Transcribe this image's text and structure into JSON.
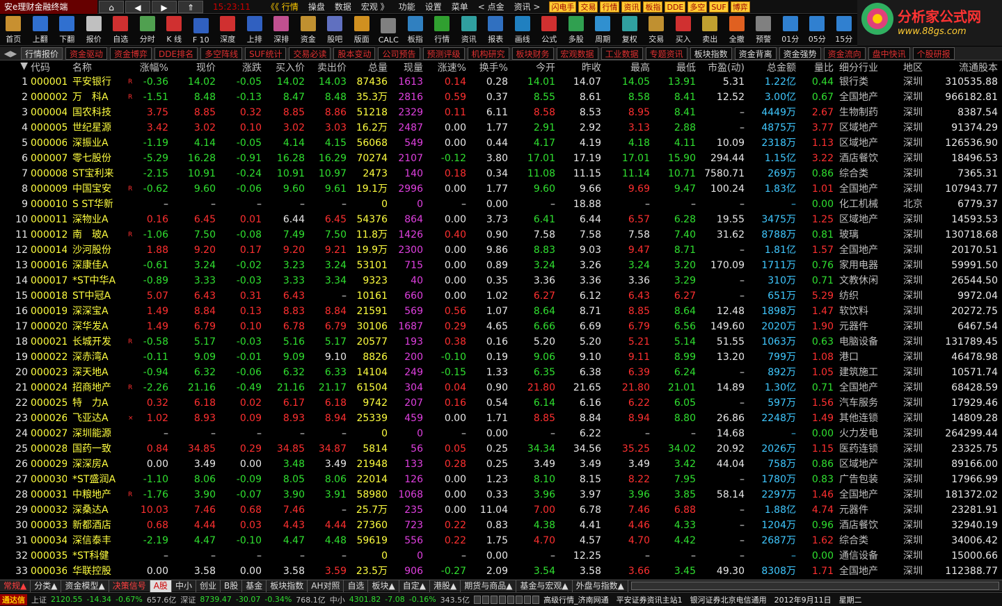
{
  "app": {
    "title": "安e理财金融终端",
    "clock": "15:23:11"
  },
  "menu": [
    "《《 行情",
    "操盘",
    "数据",
    "宏观 》",
    "功能",
    "设置",
    "菜单",
    "< 点金",
    "资讯 >"
  ],
  "quick": [
    "闪电手",
    "交易",
    "行情",
    "资讯",
    "板指",
    "DDE",
    "多空",
    "SUF",
    "博弈"
  ],
  "logo": {
    "line1": "分析家公式网",
    "line2": "www.88gs.com"
  },
  "toolbar": [
    {
      "label": "首页",
      "color": "#c89030"
    },
    {
      "label": "上翻",
      "color": "#3070d0"
    },
    {
      "label": "下翻",
      "color": "#3070d0"
    },
    {
      "label": "报价",
      "color": "#c0c0c0"
    },
    {
      "label": "自选",
      "color": "#d03030"
    },
    {
      "label": "分时",
      "color": "#50a050"
    },
    {
      "label": "K 线",
      "color": "#d03030"
    },
    {
      "label": "F 10",
      "color": "#3060c0"
    },
    {
      "label": "深度",
      "color": "#d03030"
    },
    {
      "label": "上排",
      "color": "#3060c0"
    },
    {
      "label": "深排",
      "color": "#c05090"
    },
    {
      "label": "资金",
      "color": "#c09030"
    },
    {
      "label": "股吧",
      "color": "#6070c0"
    },
    {
      "label": "版面",
      "color": "#d09020"
    },
    {
      "label": "CALC",
      "color": "#808080"
    },
    {
      "label": "板指",
      "color": "#3080c0"
    },
    {
      "label": "行情",
      "color": "#30a030"
    },
    {
      "label": "资讯",
      "color": "#30a0a0"
    },
    {
      "label": "报表",
      "color": "#3070c0"
    },
    {
      "label": "画线",
      "color": "#2080c0"
    },
    {
      "label": "公式",
      "color": "#d03030"
    },
    {
      "label": "多股",
      "color": "#30a050"
    },
    {
      "label": "周期",
      "color": "#3090d0"
    },
    {
      "label": "复权",
      "color": "#30a0a0"
    },
    {
      "label": "交易",
      "color": "#c09030"
    },
    {
      "label": "买入",
      "color": "#d03030"
    },
    {
      "label": "卖出",
      "color": "#c0a030"
    },
    {
      "label": "全撤",
      "color": "#e06020"
    },
    {
      "label": "预警",
      "color": "#808080"
    },
    {
      "label": "01分",
      "color": "#3080d0"
    },
    {
      "label": "05分",
      "color": "#3080d0"
    },
    {
      "label": "15分",
      "color": "#3080d0"
    }
  ],
  "tabs": [
    {
      "label": "行情报价",
      "style": "active"
    },
    {
      "label": "资金驱动"
    },
    {
      "label": "资金博弈"
    },
    {
      "label": "DDE排名"
    },
    {
      "label": "多空阵线"
    },
    {
      "label": "SUF统计"
    },
    {
      "label": "交易必读"
    },
    {
      "label": "股本变动"
    },
    {
      "label": "公司预告"
    },
    {
      "label": "预测评级"
    },
    {
      "label": "机构研究"
    },
    {
      "label": "板块财务"
    },
    {
      "label": "宏观数据"
    },
    {
      "label": "工业数据"
    },
    {
      "label": "专题资讯"
    },
    {
      "label": "板块指数",
      "style": "gray"
    },
    {
      "label": "资金背离",
      "style": "gray"
    },
    {
      "label": "资金强势",
      "style": "gray"
    },
    {
      "label": "资金流向"
    },
    {
      "label": "盘中快讯"
    },
    {
      "label": "个股研报"
    }
  ],
  "headers": [
    "",
    "代码",
    "名称",
    "涨幅%",
    "现价",
    "涨跌",
    "买入价",
    "卖出价",
    "总量",
    "现量",
    "涨速%",
    "换手%",
    "今开",
    "昨收",
    "最高",
    "最低",
    "市盈(动)",
    "总金额",
    "量比",
    "细分行业",
    "地区",
    "流通股本"
  ],
  "rows": [
    [
      "1",
      "000001",
      "平安银行",
      "R",
      "-0.36",
      "14.02",
      "-0.05",
      "14.02",
      "14.03",
      "87436",
      "1613",
      "0.14",
      "0.28",
      "14.01",
      "14.07",
      "14.05",
      "13.91",
      "5.31",
      "1.22亿",
      "0.44",
      "银行类",
      "深圳",
      "310535.88"
    ],
    [
      "2",
      "000002",
      "万　科A",
      "R",
      "-1.51",
      "8.48",
      "-0.13",
      "8.47",
      "8.48",
      "35.3万",
      "2816",
      "0.59",
      "0.37",
      "8.55",
      "8.61",
      "8.58",
      "8.41",
      "12.52",
      "3.00亿",
      "0.67",
      "全国地产",
      "深圳",
      "966182.81"
    ],
    [
      "3",
      "000004",
      "国农科技",
      "",
      "3.75",
      "8.85",
      "0.32",
      "8.85",
      "8.86",
      "51218",
      "2329",
      "0.11",
      "6.11",
      "8.58",
      "8.53",
      "8.95",
      "8.41",
      "–",
      "4449万",
      "2.67",
      "生物制药",
      "深圳",
      "8387.54"
    ],
    [
      "4",
      "000005",
      "世纪星源",
      "",
      "3.42",
      "3.02",
      "0.10",
      "3.02",
      "3.03",
      "16.2万",
      "2487",
      "0.00",
      "1.77",
      "2.91",
      "2.92",
      "3.13",
      "2.88",
      "–",
      "4875万",
      "3.77",
      "区域地产",
      "深圳",
      "91374.29"
    ],
    [
      "5",
      "000006",
      "深振业A",
      "",
      "-1.19",
      "4.14",
      "-0.05",
      "4.14",
      "4.15",
      "56068",
      "549",
      "0.00",
      "0.44",
      "4.17",
      "4.19",
      "4.18",
      "4.11",
      "10.09",
      "2318万",
      "1.13",
      "区域地产",
      "深圳",
      "126536.90"
    ],
    [
      "6",
      "000007",
      "零七股份",
      "",
      "-5.29",
      "16.28",
      "-0.91",
      "16.28",
      "16.29",
      "70274",
      "2107",
      "-0.12",
      "3.80",
      "17.01",
      "17.19",
      "17.01",
      "15.90",
      "294.44",
      "1.15亿",
      "3.22",
      "酒店餐饮",
      "深圳",
      "18496.53"
    ],
    [
      "7",
      "000008",
      "ST宝利来",
      "",
      "-2.15",
      "10.91",
      "-0.24",
      "10.91",
      "10.97",
      "2473",
      "140",
      "0.18",
      "0.34",
      "11.08",
      "11.15",
      "11.14",
      "10.71",
      "7580.71",
      "269万",
      "0.86",
      "综合类",
      "深圳",
      "7365.31"
    ],
    [
      "8",
      "000009",
      "中国宝安",
      "R",
      "-0.62",
      "9.60",
      "-0.06",
      "9.60",
      "9.61",
      "19.1万",
      "2996",
      "0.00",
      "1.77",
      "9.60",
      "9.66",
      "9.69",
      "9.47",
      "100.24",
      "1.83亿",
      "1.01",
      "全国地产",
      "深圳",
      "107943.77"
    ],
    [
      "9",
      "000010",
      "S ST华新",
      "",
      "–",
      "–",
      "–",
      "–",
      "–",
      "0",
      "0",
      "–",
      "0.00",
      "–",
      "18.88",
      "–",
      "–",
      "–",
      "–",
      "0.00",
      "化工机械",
      "北京",
      "6779.37"
    ],
    [
      "10",
      "000011",
      "深物业A",
      "",
      "0.16",
      "6.45",
      "0.01",
      "6.44",
      "6.45",
      "54376",
      "864",
      "0.00",
      "3.73",
      "6.41",
      "6.44",
      "6.57",
      "6.28",
      "19.55",
      "3475万",
      "1.25",
      "区域地产",
      "深圳",
      "14593.53"
    ],
    [
      "11",
      "000012",
      "南　玻A",
      "R",
      "-1.06",
      "7.50",
      "-0.08",
      "7.49",
      "7.50",
      "11.8万",
      "1426",
      "0.40",
      "0.90",
      "7.58",
      "7.58",
      "7.58",
      "7.40",
      "31.62",
      "8788万",
      "0.81",
      "玻璃",
      "深圳",
      "130718.68"
    ],
    [
      "12",
      "000014",
      "沙河股份",
      "",
      "1.88",
      "9.20",
      "0.17",
      "9.20",
      "9.21",
      "19.9万",
      "2300",
      "0.00",
      "9.86",
      "8.83",
      "9.03",
      "9.47",
      "8.71",
      "–",
      "1.81亿",
      "1.57",
      "全国地产",
      "深圳",
      "20170.51"
    ],
    [
      "13",
      "000016",
      "深康佳A",
      "",
      "-0.61",
      "3.24",
      "-0.02",
      "3.23",
      "3.24",
      "53101",
      "715",
      "0.00",
      "0.89",
      "3.24",
      "3.26",
      "3.24",
      "3.20",
      "170.09",
      "1711万",
      "0.76",
      "家用电器",
      "深圳",
      "59991.50"
    ],
    [
      "14",
      "000017",
      "*ST中华A",
      "",
      "-0.89",
      "3.33",
      "-0.03",
      "3.33",
      "3.34",
      "9323",
      "40",
      "0.00",
      "0.35",
      "3.36",
      "3.36",
      "3.36",
      "3.29",
      "–",
      "310万",
      "0.71",
      "文教休闲",
      "深圳",
      "26544.50"
    ],
    [
      "15",
      "000018",
      "ST中冠A",
      "",
      "5.07",
      "6.43",
      "0.31",
      "6.43",
      "–",
      "10161",
      "660",
      "0.00",
      "1.02",
      "6.27",
      "6.12",
      "6.43",
      "6.27",
      "–",
      "651万",
      "5.29",
      "纺织",
      "深圳",
      "9972.04"
    ],
    [
      "16",
      "000019",
      "深深宝A",
      "",
      "1.49",
      "8.84",
      "0.13",
      "8.83",
      "8.84",
      "21591",
      "569",
      "0.56",
      "1.07",
      "8.64",
      "8.71",
      "8.85",
      "8.64",
      "12.48",
      "1898万",
      "1.47",
      "软饮料",
      "深圳",
      "20272.75"
    ],
    [
      "17",
      "000020",
      "深华发A",
      "",
      "1.49",
      "6.79",
      "0.10",
      "6.78",
      "6.79",
      "30106",
      "1687",
      "0.29",
      "4.65",
      "6.66",
      "6.69",
      "6.79",
      "6.56",
      "149.60",
      "2020万",
      "1.90",
      "元器件",
      "深圳",
      "6467.54"
    ],
    [
      "18",
      "000021",
      "长城开发",
      "R",
      "-0.58",
      "5.17",
      "-0.03",
      "5.16",
      "5.17",
      "20577",
      "193",
      "0.38",
      "0.16",
      "5.20",
      "5.20",
      "5.21",
      "5.14",
      "51.55",
      "1063万",
      "0.63",
      "电脑设备",
      "深圳",
      "131789.45"
    ],
    [
      "19",
      "000022",
      "深赤湾A",
      "",
      "-0.11",
      "9.09",
      "-0.01",
      "9.09",
      "9.10",
      "8826",
      "200",
      "-0.10",
      "0.19",
      "9.06",
      "9.10",
      "9.11",
      "8.99",
      "13.20",
      "799万",
      "1.08",
      "港口",
      "深圳",
      "46478.98"
    ],
    [
      "20",
      "000023",
      "深天地A",
      "",
      "-0.94",
      "6.32",
      "-0.06",
      "6.32",
      "6.33",
      "14104",
      "249",
      "-0.15",
      "1.33",
      "6.35",
      "6.38",
      "6.39",
      "6.24",
      "–",
      "892万",
      "1.05",
      "建筑施工",
      "深圳",
      "10571.74"
    ],
    [
      "21",
      "000024",
      "招商地产",
      "R",
      "-2.26",
      "21.16",
      "-0.49",
      "21.16",
      "21.17",
      "61504",
      "304",
      "0.04",
      "0.90",
      "21.80",
      "21.65",
      "21.80",
      "21.01",
      "14.89",
      "1.30亿",
      "0.71",
      "全国地产",
      "深圳",
      "68428.59"
    ],
    [
      "22",
      "000025",
      "特　力A",
      "",
      "0.32",
      "6.18",
      "0.02",
      "6.17",
      "6.18",
      "9742",
      "207",
      "0.16",
      "0.54",
      "6.14",
      "6.16",
      "6.22",
      "6.05",
      "–",
      "597万",
      "1.56",
      "汽车服务",
      "深圳",
      "17929.46"
    ],
    [
      "23",
      "000026",
      "飞亚达A",
      "×",
      "1.02",
      "8.93",
      "0.09",
      "8.93",
      "8.94",
      "25339",
      "459",
      "0.00",
      "1.71",
      "8.85",
      "8.84",
      "8.94",
      "8.80",
      "26.86",
      "2248万",
      "1.49",
      "其他连锁",
      "深圳",
      "14809.28"
    ],
    [
      "24",
      "000027",
      "深圳能源",
      "",
      "–",
      "–",
      "–",
      "–",
      "–",
      "0",
      "0",
      "–",
      "0.00",
      "–",
      "6.22",
      "–",
      "–",
      "14.68",
      "–",
      "0.00",
      "火力发电",
      "深圳",
      "264299.44"
    ],
    [
      "25",
      "000028",
      "国药一致",
      "",
      "0.84",
      "34.85",
      "0.29",
      "34.85",
      "34.87",
      "5814",
      "56",
      "0.05",
      "0.25",
      "34.34",
      "34.56",
      "35.25",
      "34.02",
      "20.92",
      "2026万",
      "1.15",
      "医药连锁",
      "深圳",
      "23325.75"
    ],
    [
      "26",
      "000029",
      "深深房A",
      "",
      "0.00",
      "3.49",
      "0.00",
      "3.48",
      "3.49",
      "21948",
      "133",
      "0.28",
      "0.25",
      "3.49",
      "3.49",
      "3.49",
      "3.42",
      "44.04",
      "758万",
      "0.86",
      "区域地产",
      "深圳",
      "89166.00"
    ],
    [
      "27",
      "000030",
      "*ST盛润A",
      "",
      "-1.10",
      "8.06",
      "-0.09",
      "8.05",
      "8.06",
      "22014",
      "126",
      "0.00",
      "1.23",
      "8.10",
      "8.15",
      "8.22",
      "7.95",
      "–",
      "1780万",
      "0.83",
      "广告包装",
      "深圳",
      "17966.99"
    ],
    [
      "28",
      "000031",
      "中粮地产",
      "R",
      "-1.76",
      "3.90",
      "-0.07",
      "3.90",
      "3.91",
      "58980",
      "1068",
      "0.00",
      "0.33",
      "3.96",
      "3.97",
      "3.96",
      "3.85",
      "58.14",
      "2297万",
      "1.46",
      "全国地产",
      "深圳",
      "181372.02"
    ],
    [
      "29",
      "000032",
      "深桑达A",
      "",
      "10.03",
      "7.46",
      "0.68",
      "7.46",
      "–",
      "25.7万",
      "235",
      "0.00",
      "11.04",
      "7.00",
      "6.78",
      "7.46",
      "6.88",
      "–",
      "1.88亿",
      "4.74",
      "元器件",
      "深圳",
      "23281.91"
    ],
    [
      "30",
      "000033",
      "新都酒店",
      "",
      "0.68",
      "4.44",
      "0.03",
      "4.43",
      "4.44",
      "27360",
      "723",
      "0.22",
      "0.83",
      "4.38",
      "4.41",
      "4.46",
      "4.33",
      "–",
      "1204万",
      "0.96",
      "酒店餐饮",
      "深圳",
      "32940.19"
    ],
    [
      "31",
      "000034",
      "深信泰丰",
      "",
      "-2.19",
      "4.47",
      "-0.10",
      "4.47",
      "4.48",
      "59619",
      "556",
      "0.22",
      "1.75",
      "4.70",
      "4.57",
      "4.70",
      "4.42",
      "–",
      "2687万",
      "1.62",
      "综合类",
      "深圳",
      "34006.42"
    ],
    [
      "32",
      "000035",
      "*ST科健",
      "",
      "–",
      "–",
      "–",
      "–",
      "–",
      "0",
      "0",
      "–",
      "0.00",
      "–",
      "12.25",
      "–",
      "–",
      "–",
      "–",
      "0.00",
      "通信设备",
      "深圳",
      "15000.66"
    ],
    [
      "33",
      "000036",
      "华联控股",
      "",
      "0.00",
      "3.58",
      "0.00",
      "3.58",
      "3.59",
      "23.5万",
      "906",
      "-0.27",
      "2.09",
      "3.54",
      "3.58",
      "3.66",
      "3.45",
      "49.30",
      "8308万",
      "1.71",
      "全国地产",
      "深圳",
      "112388.77"
    ]
  ],
  "bottom_tabs": [
    {
      "label": "常规▲",
      "style": "red"
    },
    {
      "label": "分类▲"
    },
    {
      "label": "资金模型▲"
    },
    {
      "label": "决策信号",
      "style": "red"
    },
    {
      "label": "A股",
      "style": "act"
    },
    {
      "label": "中小"
    },
    {
      "label": "创业"
    },
    {
      "label": "B股"
    },
    {
      "label": "基金"
    },
    {
      "label": "板块指数"
    },
    {
      "label": "AH对照"
    },
    {
      "label": "自选"
    },
    {
      "label": "板块▲"
    },
    {
      "label": "自定▲"
    },
    {
      "label": "港股▲"
    },
    {
      "label": "期货与商品▲"
    },
    {
      "label": "基金与宏观▲"
    },
    {
      "label": "外盘与指数▲"
    }
  ],
  "status": {
    "brand": "通达信",
    "sh_label": "上证",
    "sh_val": "2120.55",
    "sh_chg": "-14.34",
    "sh_pct": "-0.67%",
    "sh_amt": "657.6亿",
    "sz_label": "深证",
    "sz_val": "8739.47",
    "sz_chg": "-30.07",
    "sz_pct": "-0.34%",
    "sz_amt": "768.1亿",
    "zx_label": "中小",
    "zx_val": "4301.82",
    "zx_chg": "-7.08",
    "zx_pct": "-0.16%",
    "zx_amt": "343.5亿",
    "msg": "高级行情_济南网通　平安证券资讯主站1　银河证券北京电信通用　2012年9月11日　星期二"
  }
}
